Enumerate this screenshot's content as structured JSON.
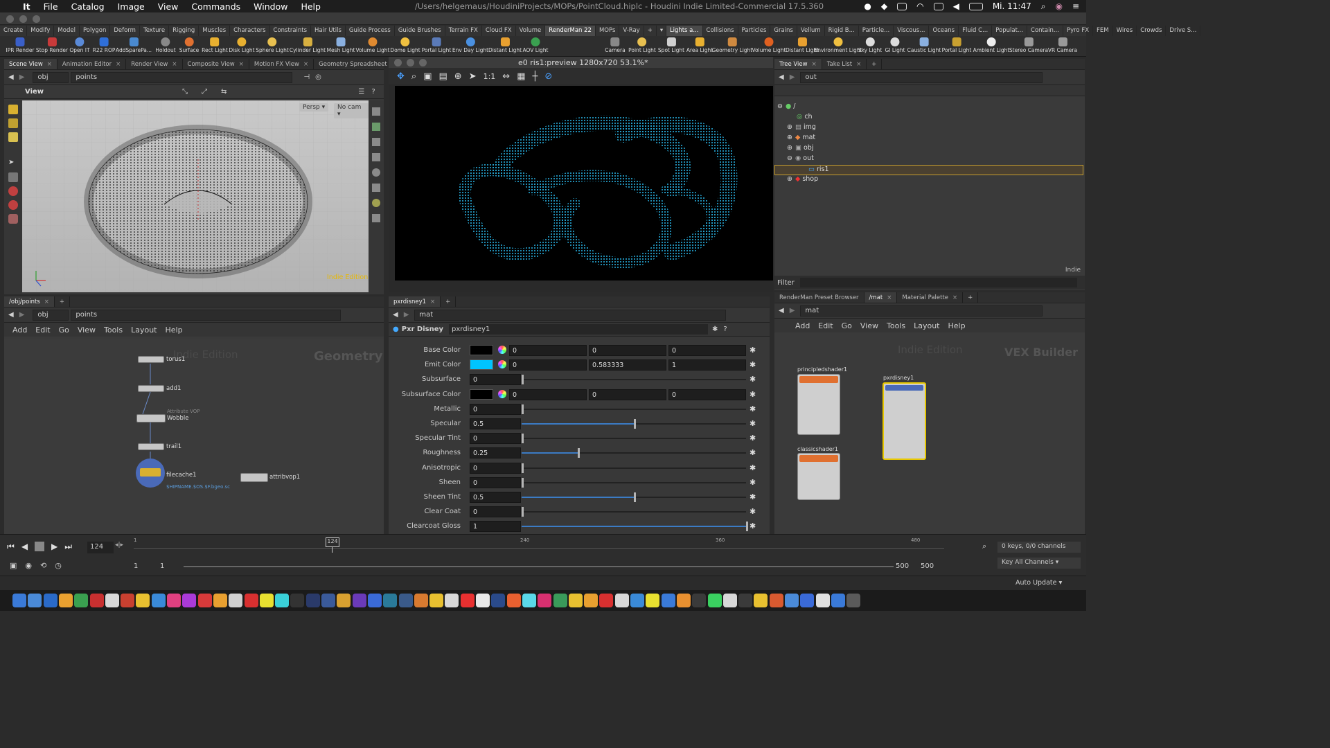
{
  "menubar": {
    "items": [
      "It",
      "File",
      "Catalog",
      "Image",
      "View",
      "Commands",
      "Window",
      "Help"
    ],
    "path": "/Users/helgemaus/HoudiniProjects/MOPs/PointCloud.hiplc - Houdini Indie Limited-Commercial 17.5.360",
    "clock": "Mi. 11:47"
  },
  "shelf_tabs_left": [
    "Create",
    "Modify",
    "Model",
    "Polygon",
    "Deform",
    "Texture",
    "Rigging",
    "Muscles",
    "Characters",
    "Constraints",
    "Hair Utils",
    "Guide Process",
    "Guide Brushes",
    "Terrain FX",
    "Cloud FX",
    "Volume",
    "RenderMan 22",
    "MOPs",
    "V-Ray"
  ],
  "shelf_tabs_right": [
    "Lights a...",
    "Collisions",
    "Particles",
    "Grains",
    "Vellum",
    "Rigid B...",
    "Particle...",
    "Viscous...",
    "Oceans",
    "Fluid C...",
    "Populat...",
    "Contain...",
    "Pyro FX",
    "FEM",
    "Wires",
    "Crowds",
    "Drive S..."
  ],
  "shelf_tools_left": [
    "IPR Render",
    "Stop Render",
    "Open IT",
    "R22 ROP",
    "AddSparePa...",
    "Holdout",
    "Surface",
    "Rect Light",
    "Disk Light",
    "Sphere Light",
    "Cylinder Light",
    "Mesh Light",
    "Volume Light",
    "Dome Light",
    "Portal Light",
    "Env Day Light",
    "Distant Light",
    "AOV Light"
  ],
  "shelf_tools_right": [
    "Camera",
    "Point Light",
    "Spot Light",
    "Area Light",
    "Geometry Light",
    "Volume Light",
    "Distant Light",
    "Environment Light",
    "Sky Light",
    "GI Light",
    "Caustic Light",
    "Portal Light",
    "Ambient Light",
    "Stereo Camera",
    "VR Camera"
  ],
  "scene_tabs": [
    "Scene View",
    "Animation Editor",
    "Render View",
    "Composite View",
    "Motion FX View",
    "Geometry Spreadsheet"
  ],
  "scene_path": {
    "root": "obj",
    "node": "points"
  },
  "viewport": {
    "title": "View",
    "persp": "Persp",
    "cam": "No cam",
    "watermark": "Indie Edition"
  },
  "render_window": {
    "title": "e0 ris1:preview 1280x720 53.1%*"
  },
  "tree": {
    "tabs": [
      "Tree View",
      "Take List"
    ],
    "path": "out",
    "items": [
      "/",
      "ch",
      "img",
      "mat",
      "obj",
      "out",
      "ris1",
      "shop"
    ],
    "footer": "Indie",
    "filter_label": "Filter"
  },
  "network": {
    "tab": "/obj/points",
    "path_root": "obj",
    "path_node": "points",
    "menu": [
      "Add",
      "Edit",
      "Go",
      "View",
      "Tools",
      "Layout",
      "Help"
    ],
    "watermark": "Indie Edition",
    "context": "Geometry",
    "nodes": [
      "torus1",
      "add1",
      "Wobble",
      "trail1",
      "filecache1",
      "attribvop1"
    ],
    "wobble_type": "Attribute VOP",
    "filecache_path": "$HIPNAME.$OS.$F.bgeo.sc"
  },
  "params": {
    "tab": "pxrdisney1",
    "path": "mat",
    "type": "Pxr Disney",
    "name": "pxrdisney1",
    "rows": [
      {
        "label": "Base Color",
        "values": [
          "0",
          "0",
          "0"
        ],
        "swatch": "#000000"
      },
      {
        "label": "Emit Color",
        "values": [
          "0",
          "0.583333",
          "1"
        ],
        "swatch": "#00c4ff"
      },
      {
        "label": "Subsurface",
        "value": "0",
        "slider": 0
      },
      {
        "label": "Subsurface Color",
        "values": [
          "0",
          "0",
          "0"
        ],
        "swatch": "#000000"
      },
      {
        "label": "Metallic",
        "value": "0",
        "slider": 0
      },
      {
        "label": "Specular",
        "value": "0.5",
        "slider": 0.5
      },
      {
        "label": "Specular Tint",
        "value": "0",
        "slider": 0
      },
      {
        "label": "Roughness",
        "value": "0.25",
        "slider": 0.25
      },
      {
        "label": "Anisotropic",
        "value": "0",
        "slider": 0
      },
      {
        "label": "Sheen",
        "value": "0",
        "slider": 0
      },
      {
        "label": "Sheen Tint",
        "value": "0.5",
        "slider": 0.5
      },
      {
        "label": "Clear Coat",
        "value": "0",
        "slider": 0
      },
      {
        "label": "Clearcoat Gloss",
        "value": "1",
        "slider": 1
      }
    ]
  },
  "vex": {
    "tabs": [
      "RenderMan Preset Browser",
      "/mat",
      "Material Palette"
    ],
    "path": "mat",
    "menu": [
      "Add",
      "Edit",
      "Go",
      "View",
      "Tools",
      "Layout",
      "Help"
    ],
    "watermark": "Indie Edition",
    "context": "VEX Builder",
    "nodes": [
      "principledshader1",
      "classicshader1",
      "pxrdisney1"
    ]
  },
  "timeline": {
    "frame": "124",
    "marker": "124",
    "ticks": [
      "1",
      "240",
      "360",
      "480"
    ],
    "start": "1",
    "start2": "1",
    "end": "500",
    "end2": "500",
    "keys": "0 keys, 0/0 channels",
    "key_mode": "Key All Channels",
    "auto_update": "Auto Update"
  }
}
